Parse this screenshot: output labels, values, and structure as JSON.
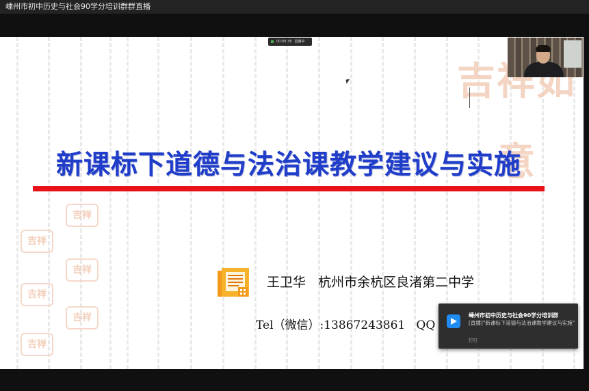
{
  "window": {
    "title": "嵊州市初中历史与社会90学分培训群群直播"
  },
  "recording": {
    "time": "00:00:38",
    "status": "直播中"
  },
  "slide": {
    "title": "新课标下道德与法治课教学建议与实施",
    "author_line": "王卫华   杭州市余杭区良渚第二中学",
    "contact_line": "Tel（微信）:13867243861   QQ",
    "stamp_text": "吉祥如意",
    "stamp_small_text": "吉祥",
    "title_color": "#1f3dc9",
    "underline_color": "#e8131a"
  },
  "notification": {
    "title": "嵊州市初中历史与社会90学分培训群",
    "body": "[直播]\"新课标下道德与法治课教学建议与实施\"",
    "footer": "钉钉",
    "icon": "dingtalk-icon",
    "accent": "#1e8cf0"
  }
}
